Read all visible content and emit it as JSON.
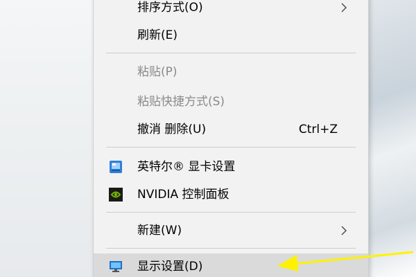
{
  "menu": {
    "sort_by": "排序方式(O)",
    "refresh": "刷新(E)",
    "paste": "粘贴(P)",
    "paste_shortcut": "粘贴快捷方式(S)",
    "undo_delete": "撤消 删除(U)",
    "undo_shortcut": "Ctrl+Z",
    "intel_graphics": "英特尔® 显卡设置",
    "nvidia_panel": "NVIDIA 控制面板",
    "new": "新建(W)",
    "display_settings": "显示设置(D)"
  },
  "icons": {
    "submenu": "chevron-right-icon",
    "intel": "intel-graphics-icon",
    "nvidia": "nvidia-icon",
    "display": "monitor-icon",
    "annotation": "yellow-arrow-icon"
  },
  "colors": {
    "menu_bg": "#f2f2f2",
    "highlight": "#dadada",
    "disabled_text": "#8a8a8a",
    "annotation_arrow": "#fff200",
    "intel_blue": "#2f7fd6",
    "nvidia_green": "#76b900"
  }
}
